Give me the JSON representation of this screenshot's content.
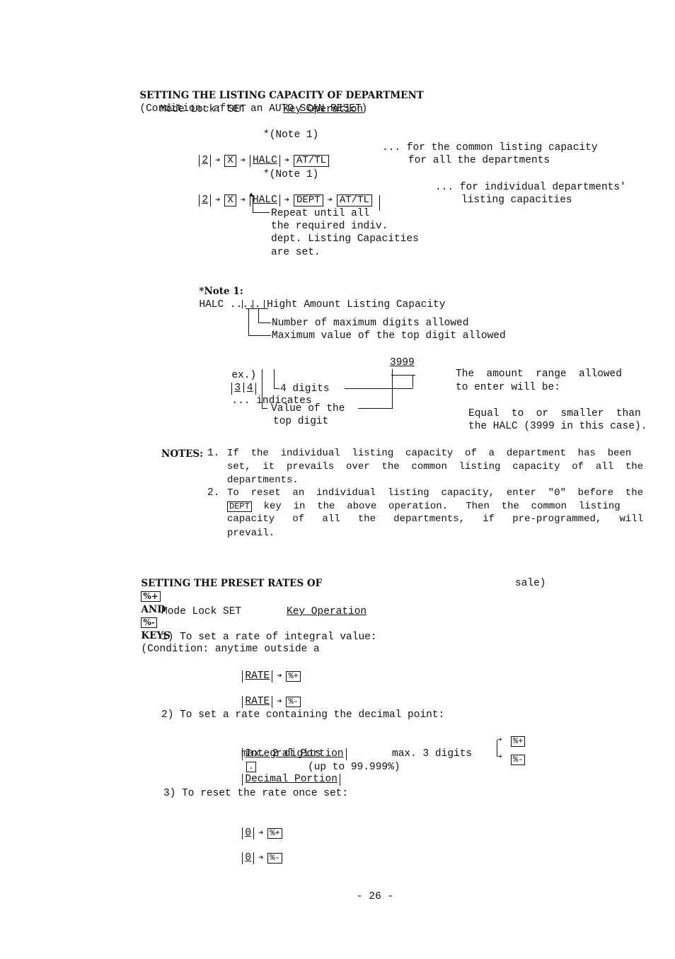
{
  "section1": {
    "heading_bold": "SETTING THE LISTING CAPACITY OF DEPARTMENT",
    "heading_condition": "(Condition: after an AUTO SCAN RESET)",
    "mode_lock": "Mode Lock: SET",
    "key_operation": "Key Operation",
    "note_ref": "*(Note 1)",
    "row1": {
      "keys": [
        "2",
        "X",
        "HALC",
        "AT/TL"
      ],
      "desc_line1": "... for the common listing capacity",
      "desc_line2": "for all the departments"
    },
    "row2": {
      "keys": [
        "2",
        "X",
        "HALC",
        "DEPT",
        "AT/TL"
      ],
      "desc_line1": "... for individual departments'",
      "desc_line2": "listing capacities"
    },
    "repeat_note": [
      "Repeat until all",
      "the required indiv.",
      "dept. Listing Capacities",
      "are set."
    ],
    "note1": {
      "label": "*Note 1:",
      "text": "HALC ..... Hight Amount Listing Capacity",
      "callout1": "Number of maximum digits allowed",
      "callout2": "Maximum value of the top digit allowed"
    },
    "example": {
      "prefix": "ex.)",
      "digits": [
        "3",
        "4"
      ],
      "indicates": "... indicates",
      "value": "3999",
      "callout_digits": "4 digits",
      "callout_top_1": "Value of the",
      "callout_top_2": "top digit",
      "range_1": "The  amount  range  allowed",
      "range_2": "to enter will be:",
      "range_3": "Equal  to  or  smaller  than",
      "range_4": "the HALC (3999 in this case)."
    },
    "notes": {
      "label": "NOTES:",
      "item1_num": "1.",
      "item1_lines": [
        "If  the  individual  listing  capacity  of  a  department  has  been",
        "set,  it  prevails  over  the  common  listing  capacity  of  all  the",
        "departments."
      ],
      "item2_num": "2.",
      "item2_line1": "To  reset  an  individual  listing  capacity,  enter  \"0\"  before  the",
      "item2_key": "DEPT",
      "item2_line2_rest": "  key  in  the  above  operation.   Then  the  common  listing",
      "item2_line3": "capacity   of   all   the   departments,   if   pre-programmed,   will",
      "item2_line4": "prevail."
    }
  },
  "section2": {
    "heading_part1": "SETTING THE PRESET RATES OF",
    "key_plus": "%+",
    "heading_and": "AND",
    "key_minus": "%-",
    "heading_keys": "KEYS",
    "condition_1": "(Condition: anytime outside a",
    "condition_2": "sale)",
    "mode_lock": "Mode Lock SET",
    "key_operation": "Key Operation",
    "step1": "1) To set a rate of integral value:",
    "rate_key": "RATE",
    "step2": "2) To set a rate containing the decimal point:",
    "integral_portion": "Integral Portion",
    "decimal_key": ".",
    "decimal_portion": "Decimal Portion",
    "max2": "max. 2 digits",
    "max3": "max. 3 digits",
    "upto": "(up to 99.999%)",
    "step3": "3) To reset the rate once set:",
    "zero_key": "0"
  },
  "footer": {
    "page_number": "- 26 -"
  }
}
